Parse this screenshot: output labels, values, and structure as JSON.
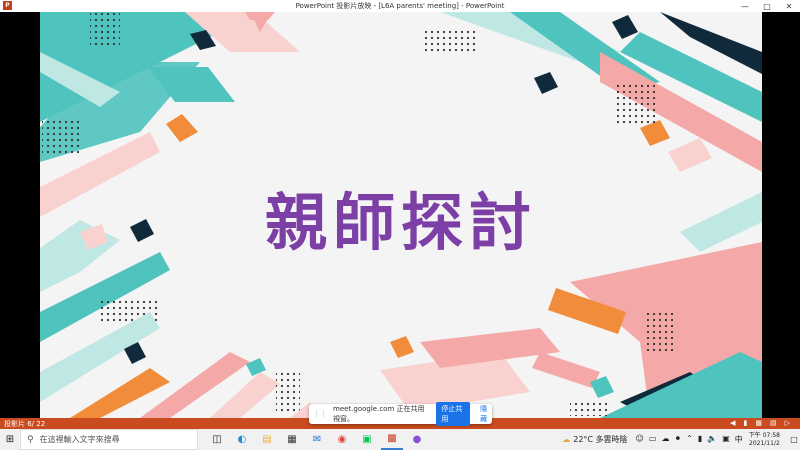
{
  "window": {
    "title": "PowerPoint 投影片放映 - [L6A parents' meeting] - PowerPoint",
    "app_icon": "P",
    "minimize_icon": "minimize-icon",
    "maximize_icon": "maximize-icon",
    "close_icon": "close-icon"
  },
  "slide": {
    "title": "親師探討",
    "title_color": "#7b3fa6",
    "palette": {
      "teal": "#4fc3bd",
      "pink": "#f4a9a8",
      "orange": "#f08c3a",
      "navy": "#10293b",
      "light_teal": "#bfe7e4",
      "light_pink": "#f9d2d0",
      "background": "#f4f4f4"
    }
  },
  "statusbar": {
    "slide_number": "投影片 6/ 22",
    "color": "#c94b1f"
  },
  "share_banner": {
    "message": "meet.google.com 正在共用視窗。",
    "stop_label": "停止共用",
    "hide_label": "隱藏"
  },
  "taskbar": {
    "search_placeholder": "在這裡輸入文字來搜尋",
    "apps": [
      "task-view-icon",
      "edge-icon",
      "file-explorer-icon",
      "store-icon",
      "mail-icon",
      "chrome-icon",
      "line-icon",
      "powerpoint-icon",
      "photos-icon"
    ],
    "weather": "22°C 多雲時陰",
    "time": "下午 07:58",
    "date": "2021/11/2"
  }
}
